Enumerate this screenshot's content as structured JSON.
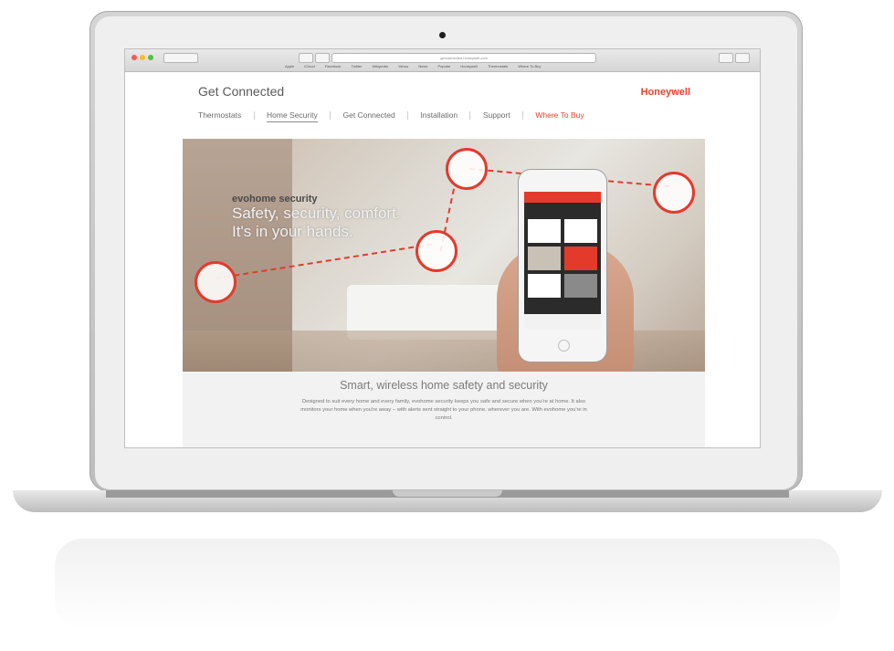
{
  "browser": {
    "url": "getconnected.honeywell.com",
    "bookmarks": [
      "Apple",
      "iCloud",
      "Facebook",
      "Twitter",
      "Wikipedia",
      "Yahoo",
      "News",
      "Popular",
      "Honeywell",
      "Thermostats",
      "Where To Buy"
    ]
  },
  "site": {
    "title": "Get Connected",
    "brand": "Honeywell",
    "nav": [
      "Thermostats",
      "Home Security",
      "Get Connected",
      "Installation",
      "Support",
      "Where To Buy"
    ],
    "active_nav": "Home Security",
    "accent_color": "#e8412c"
  },
  "hero": {
    "kicker": "evohome security",
    "line1": "Safety, security, comfort.",
    "line2": "It's in your hands."
  },
  "intro": {
    "heading": "Smart, wireless home safety and security",
    "body": "Designed to suit every home and every family, evohome security keeps you safe and secure when you're at home. It also monitors your home when you're away – with alerts sent straight to your phone, wherever you are. With evohome you're in control."
  },
  "icons": [
    "camera-icon",
    "sensor-icon",
    "phone-icon"
  ]
}
